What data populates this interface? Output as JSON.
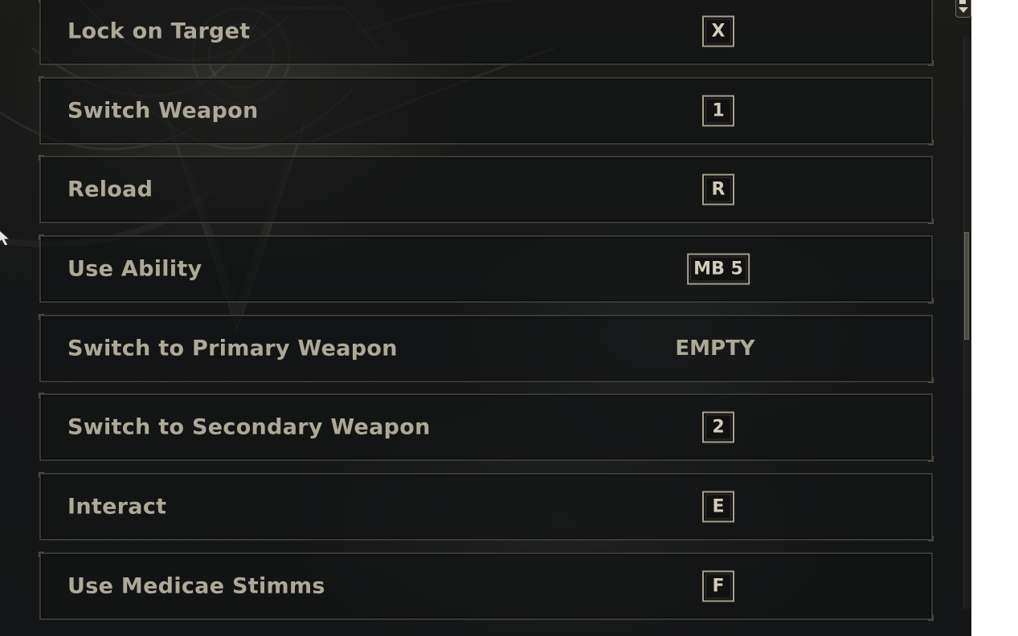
{
  "keybindings": [
    {
      "action": "Lock on Target",
      "key": "X",
      "bound": true
    },
    {
      "action": "Switch Weapon",
      "key": "1",
      "bound": true
    },
    {
      "action": "Reload",
      "key": "R",
      "bound": true
    },
    {
      "action": "Use Ability",
      "key": "MB 5",
      "bound": true
    },
    {
      "action": "Switch to Primary Weapon",
      "key": "EMPTY",
      "bound": false
    },
    {
      "action": "Switch to Secondary Weapon",
      "key": "2",
      "bound": true
    },
    {
      "action": "Interact",
      "key": "E",
      "bound": true
    },
    {
      "action": "Use Medicae Stimms",
      "key": "F",
      "bound": true
    }
  ],
  "scroll": {
    "position_fraction": 0.42
  },
  "colors": {
    "label": "#aea897",
    "keycap_border": "#a59f8e",
    "keycap_text": "#d1cbb9",
    "row_border": "#3a3a33",
    "background": "#161718"
  },
  "icons": {
    "cursor": "cursor-arrow-icon",
    "scroll_up": "scroll-up-arrow-icon"
  }
}
